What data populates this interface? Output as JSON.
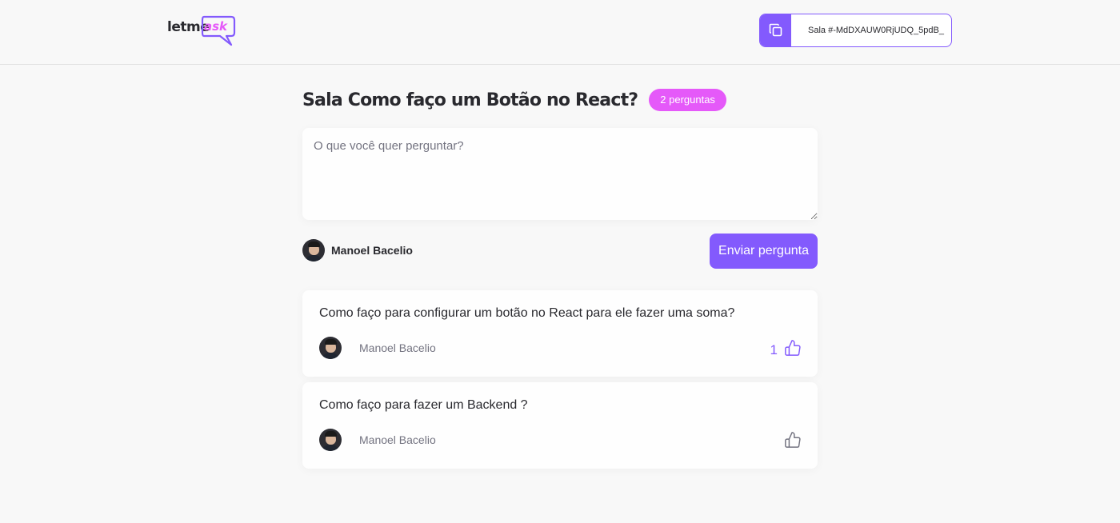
{
  "header": {
    "logo": {
      "text": "letme",
      "accent_text": "ask"
    },
    "room_code": {
      "label": "Sala #-MdDXAUW0RjUDQ_5pdB_"
    }
  },
  "room": {
    "title": "Sala Como faço um Botão no React?",
    "count_label": "2 perguntas"
  },
  "form": {
    "placeholder": "O que você quer perguntar?",
    "user_name": "Manoel Bacelio",
    "send_label": "Enviar pergunta"
  },
  "questions": [
    {
      "text": "Como faço para configurar um botão no React para ele fazer uma soma?",
      "author": "Manoel Bacelio",
      "likes": "1",
      "liked": true
    },
    {
      "text": "Como faço para fazer um Backend ?",
      "author": "Manoel Bacelio",
      "likes": "",
      "liked": false
    }
  ],
  "colors": {
    "primary": "#835afd",
    "accent": "#e559f9",
    "background": "#f8f8f8",
    "text": "#29292e",
    "muted": "#737380"
  },
  "icons": {
    "copy": "copy-icon",
    "like": "thumbs-up-icon",
    "logo_bubble": "speech-bubble-icon"
  }
}
